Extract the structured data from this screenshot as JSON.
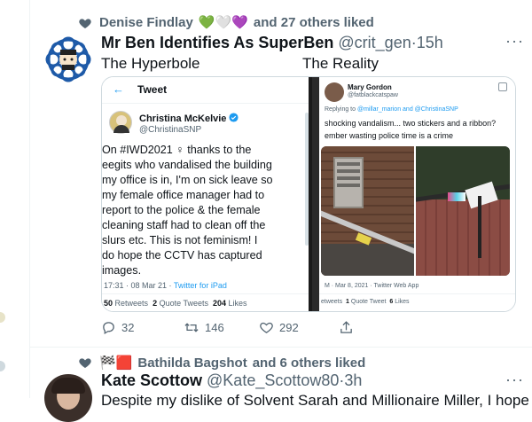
{
  "tweet1": {
    "social_context": {
      "liker_name": "Denise Findlay",
      "emojis": "💚🤍💜",
      "tail": "and 27 others liked"
    },
    "author_name": "Mr Ben Identifies As SuperBen",
    "handle": "@crit_gen",
    "dot": "·",
    "time": "15h",
    "text_left": "The Hyperbole",
    "text_right": "The Reality",
    "media": {
      "left": {
        "header_back": "←",
        "header_title": "Tweet",
        "author_name": "Christina McKelvie",
        "author_handle": "@ChristinaSNP",
        "lines": [
          "On #IWD2021 ♀ thanks to the",
          "eegits who vandalised the building",
          "my office is in, I'm on sick leave so",
          "my female office manager had to",
          "report to the police & the female",
          "cleaning staff had to clean off the",
          "slurs etc. This is not feminism! I",
          "do hope the CCTV has captured",
          "images."
        ],
        "meta_time": "17:31 · 08 Mar 21 · ",
        "meta_source": "Twitter for iPad",
        "retweets_num": "50",
        "retweets_label": "Retweets",
        "quotes_num": "2",
        "quotes_label": "Quote Tweets",
        "likes_num": "204",
        "likes_label": "Likes"
      },
      "right": {
        "author_name": "Mary Gordon",
        "author_handle": "@fatblackcatspaw",
        "reply_prefix": "Replying to ",
        "reply_mentions": "@millar_marion and @ChristinaSNP",
        "line1": "shocking vandalism... two stickers and a ribbon?",
        "line2": "ember wasting police time is a crime",
        "meta": "M · Mar 8, 2021 · Twitter Web App",
        "retweets_label": "etweets",
        "quotes_num": "1",
        "quotes_label": "Quote Tweet",
        "likes_num": "6",
        "likes_label": "Likes"
      }
    },
    "actions": {
      "reply_count": "32",
      "retweet_count": "146",
      "like_count": "292"
    }
  },
  "tweet2": {
    "social_context": {
      "emojis": "🏁🟥",
      "liker_name": "Bathilda Bagshot",
      "tail": "and 6 others liked"
    },
    "author_name": "Kate Scottow",
    "handle": "@Kate_Scottow80",
    "dot": "·",
    "time": "3h",
    "text_partial": "Despite my dislike of Solvent Sarah and Millionaire Miller, I hope that"
  },
  "colors": {
    "accent": "#1d9bf0",
    "secondary_text": "#536471",
    "border": "#cfd9de"
  },
  "icons": [
    "heart-icon",
    "more-icon",
    "back-arrow-icon",
    "verified-icon",
    "reply-icon",
    "retweet-icon",
    "like-icon",
    "share-icon"
  ]
}
